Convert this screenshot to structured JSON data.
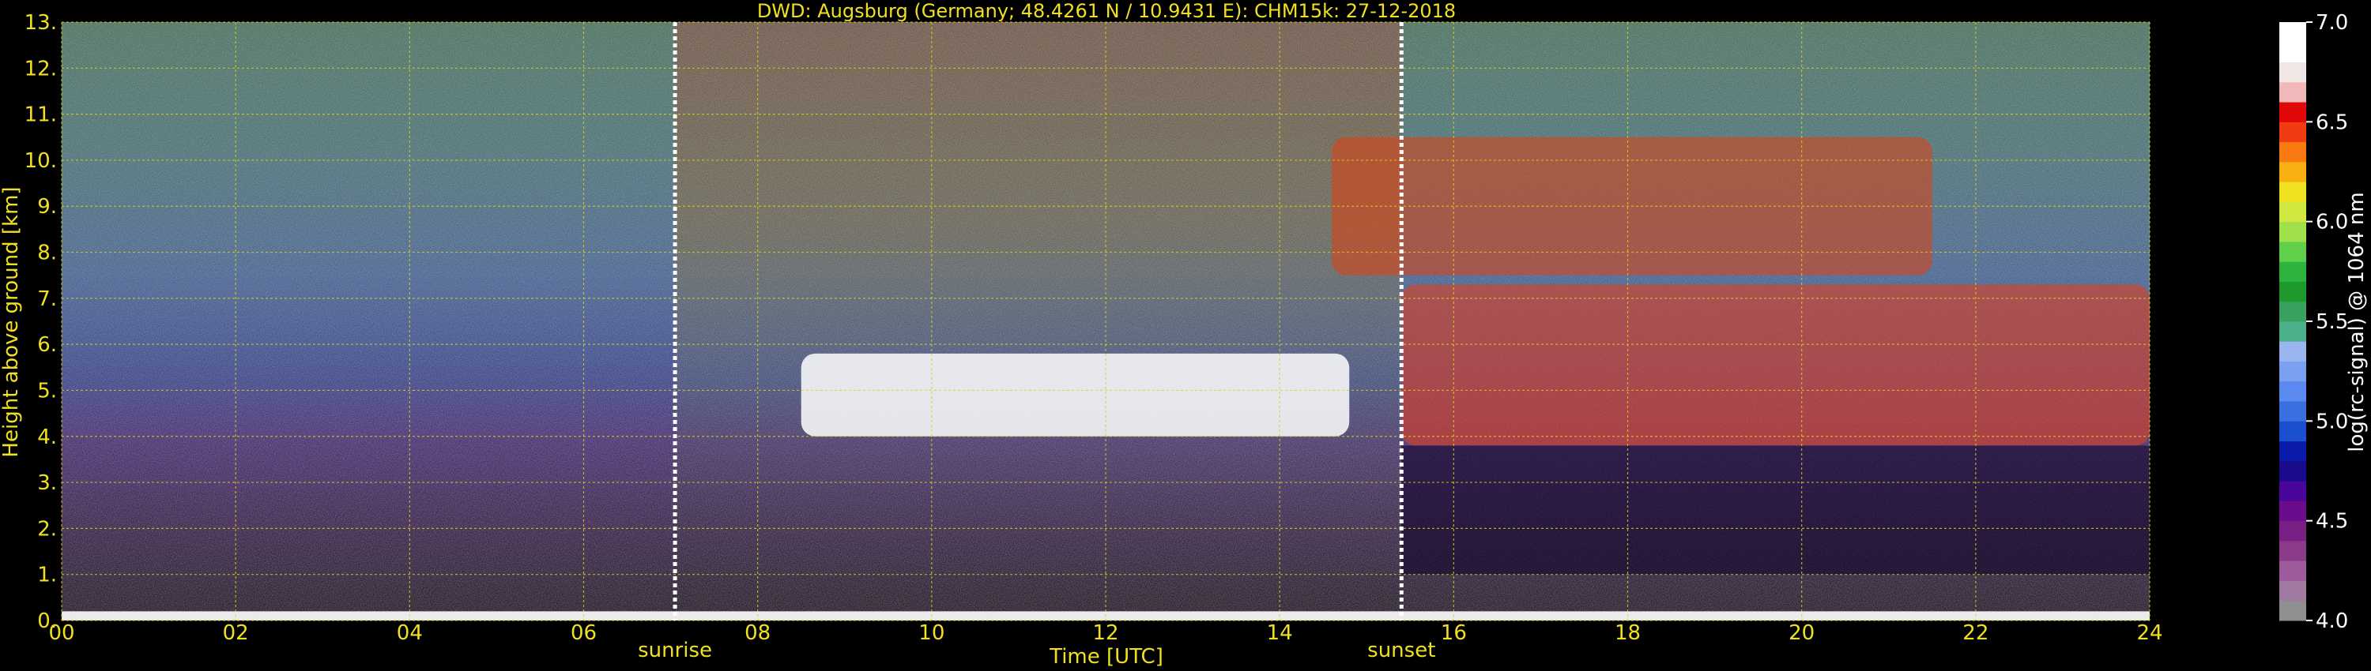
{
  "chart_data": {
    "type": "heatmap",
    "title": "DWD: Augsburg (Germany; 48.4261 N / 10.9431 E):    CHM15k: 27-12-2018",
    "xlabel": "Time [UTC]",
    "ylabel": "Height above ground [km]",
    "xlim": [
      0,
      24
    ],
    "ylim": [
      0,
      13
    ],
    "x_ticks": [
      "00",
      "02",
      "04",
      "06",
      "08",
      "10",
      "12",
      "14",
      "16",
      "18",
      "20",
      "22",
      "24"
    ],
    "y_ticks": [
      "0.",
      "1.",
      "2.",
      "3.",
      "4.",
      "5.",
      "6.",
      "7.",
      "8.",
      "9.",
      "10.",
      "11.",
      "12.",
      "13."
    ],
    "grid": true,
    "markers": [
      {
        "label": "sunrise",
        "x": 7.05
      },
      {
        "label": "sunset",
        "x": 15.4
      }
    ],
    "colorbar": {
      "label": "log(rc-signal) @ 1064 nm",
      "range": [
        4.0,
        7.0
      ],
      "ticks": [
        "4.0",
        "4.5",
        "5.0",
        "5.5",
        "6.0",
        "6.5",
        "7.0"
      ],
      "colors": [
        "#8f8f8f",
        "#a07aa0",
        "#9d5b9d",
        "#8a3c8a",
        "#7a1f86",
        "#6a0c8c",
        "#4a069a",
        "#1a0a8c",
        "#0a1aaa",
        "#1a4fcf",
        "#3a6fe0",
        "#5a8af0",
        "#7aa0f0",
        "#9ab4f0",
        "#4cb08a",
        "#39a060",
        "#1e9a2c",
        "#2cb43c",
        "#60d04a",
        "#a0e04a",
        "#d0e840",
        "#f0e020",
        "#f8b010",
        "#f87a10",
        "#f03c10",
        "#e00808",
        "#f0b8b8",
        "#f0e6e6",
        "#ffffff",
        "#ffffff"
      ]
    },
    "features": [
      {
        "name": "surface layer",
        "x": [
          0,
          24
        ],
        "height_km": [
          0.0,
          0.2
        ]
      },
      {
        "name": "mid cloud layer (day)",
        "x": [
          8.5,
          14.8
        ],
        "height_km": [
          4.0,
          5.8
        ]
      },
      {
        "name": "cirrus",
        "x": [
          14.6,
          21.5
        ],
        "height_km": [
          7.5,
          10.5
        ]
      },
      {
        "name": "evening cloud deck",
        "x": [
          15.4,
          24
        ],
        "height_km": [
          3.8,
          7.3
        ]
      }
    ]
  }
}
